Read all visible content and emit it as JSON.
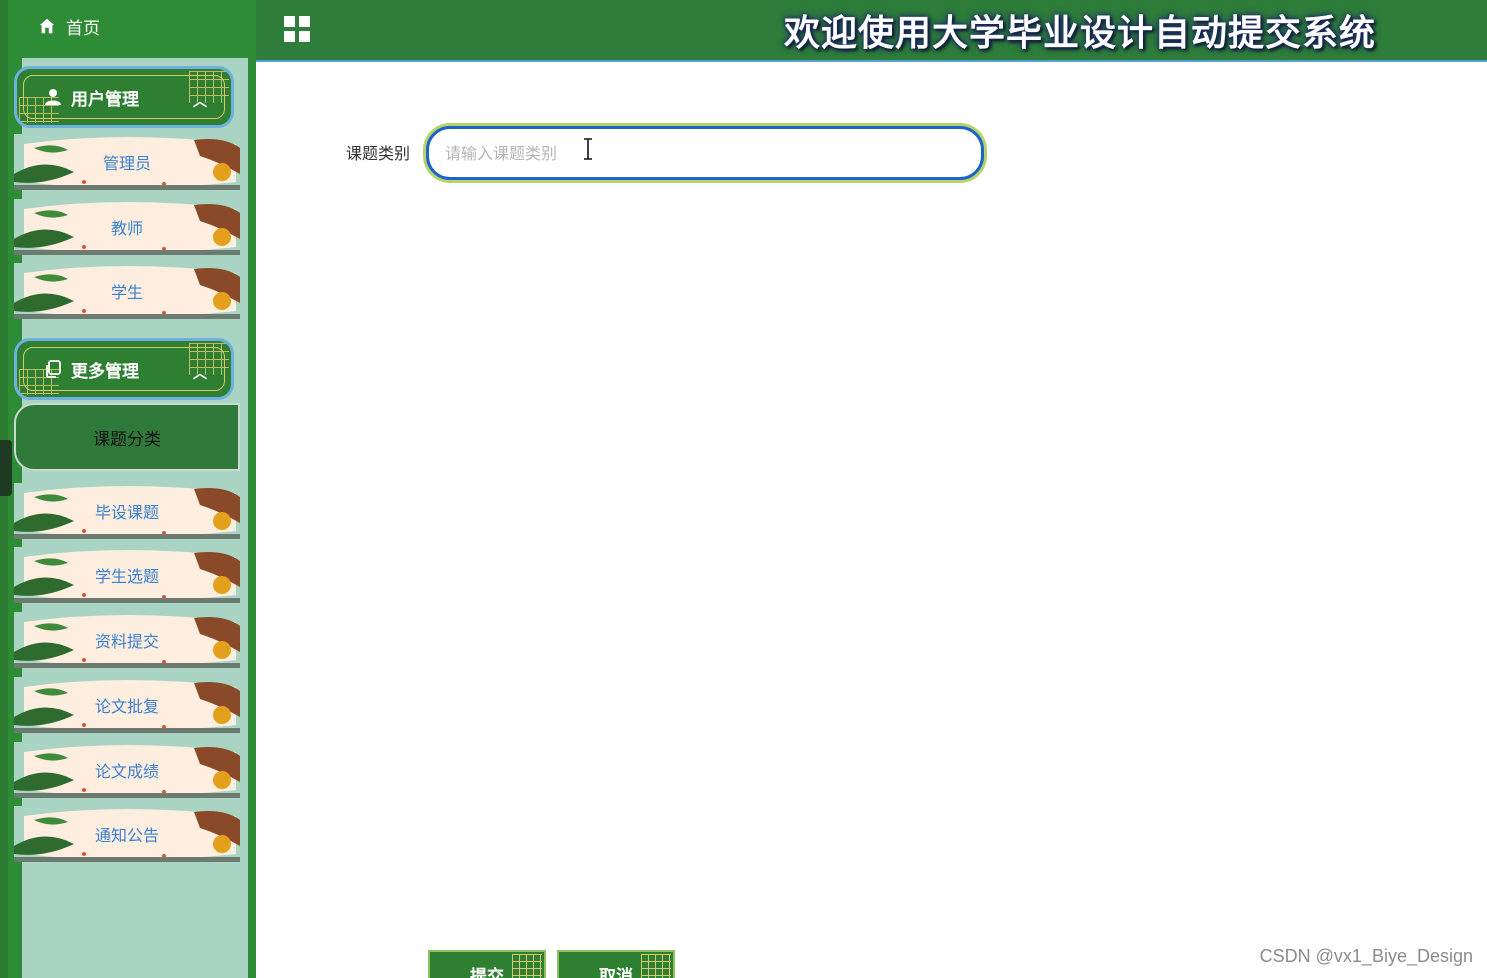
{
  "sidebar": {
    "home_label": "首页",
    "groups": [
      {
        "label": "用户管理",
        "icon": "user-icon",
        "items": [
          "管理员",
          "教师",
          "学生"
        ]
      },
      {
        "label": "更多管理",
        "icon": "copy-icon",
        "items": [
          "课题分类",
          "毕设课题",
          "学生选题",
          "资料提交",
          "论文批复",
          "论文成绩",
          "通知公告"
        ]
      }
    ],
    "active_item": "课题分类"
  },
  "header": {
    "title": "欢迎使用大学毕业设计自动提交系统",
    "menu_icon": "grid-icon"
  },
  "form": {
    "field_label": "课题类别",
    "field_placeholder": "请输入课题类别",
    "field_value": "",
    "submit_label": "提交",
    "cancel_label": "取消"
  },
  "watermark": "CSDN @vx1_Biye_Design",
  "colors": {
    "sidebar_green": "#2e8b36",
    "header_green": "#2e7d3a",
    "menu_text_blue": "#3b7fd0",
    "input_border": "#1e63c8"
  }
}
